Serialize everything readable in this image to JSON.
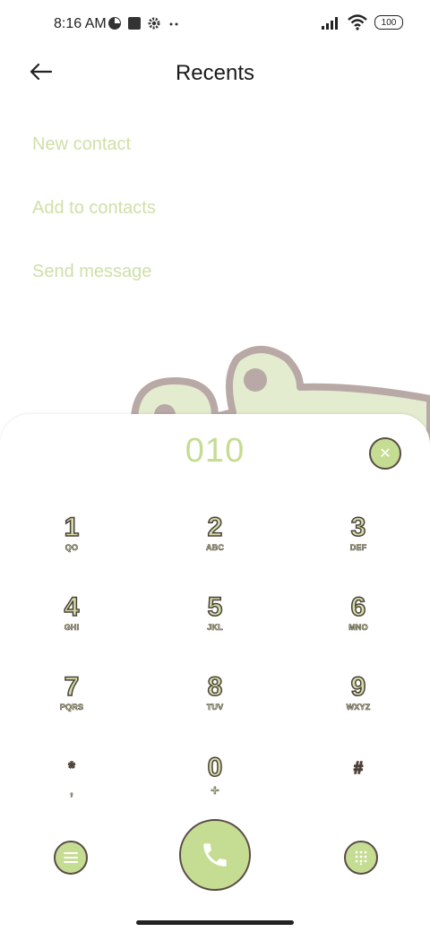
{
  "status": {
    "time": "8:16 AM",
    "battery": "100",
    "icons_left": [
      "app-icon",
      "stop-icon",
      "gear-icon",
      "more-dots-icon"
    ],
    "icons_right": [
      "signal-icon",
      "wifi-icon",
      "battery-icon"
    ]
  },
  "header": {
    "title": "Recents"
  },
  "actions": [
    "New contact",
    "Add to contacts",
    "Send message"
  ],
  "dialer": {
    "number": "010",
    "keys": [
      {
        "digit": "1",
        "sub": "QO"
      },
      {
        "digit": "2",
        "sub": "ABC"
      },
      {
        "digit": "3",
        "sub": "DEF"
      },
      {
        "digit": "4",
        "sub": "GHI"
      },
      {
        "digit": "5",
        "sub": "JKL"
      },
      {
        "digit": "6",
        "sub": "MNO"
      },
      {
        "digit": "7",
        "sub": "PQRS"
      },
      {
        "digit": "8",
        "sub": "TUV"
      },
      {
        "digit": "9",
        "sub": "WXYZ"
      },
      {
        "digit": "*",
        "sub": ","
      },
      {
        "digit": "0",
        "sub": "+"
      },
      {
        "digit": "#",
        "sub": ""
      }
    ]
  },
  "colors": {
    "accent": "#c5dc93",
    "outline": "#5a4a44",
    "action_text": "#cfe0a8"
  }
}
